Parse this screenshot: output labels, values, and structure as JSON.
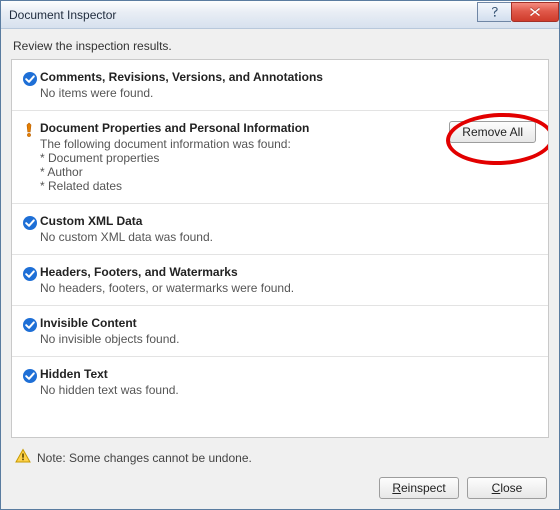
{
  "window": {
    "title": "Document Inspector"
  },
  "subtitle": "Review the inspection results.",
  "sections": [
    {
      "status": "ok",
      "title": "Comments, Revisions, Versions, and Annotations",
      "desc": "No items were found."
    },
    {
      "status": "warn",
      "title": "Document Properties and Personal Information",
      "desc": "The following document information was found:",
      "lines": [
        "* Document properties",
        "* Author",
        "* Related dates"
      ],
      "remove_label": "Remove All"
    },
    {
      "status": "ok",
      "title": "Custom XML Data",
      "desc": "No custom XML data was found."
    },
    {
      "status": "ok",
      "title": "Headers, Footers, and Watermarks",
      "desc": "No headers, footers, or watermarks were found."
    },
    {
      "status": "ok",
      "title": "Invisible Content",
      "desc": "No invisible objects found."
    },
    {
      "status": "ok",
      "title": "Hidden Text",
      "desc": "No hidden text was found."
    }
  ],
  "footer": {
    "note": "Note: Some changes cannot be undone.",
    "reinspect": "Reinspect",
    "close": "Close"
  }
}
